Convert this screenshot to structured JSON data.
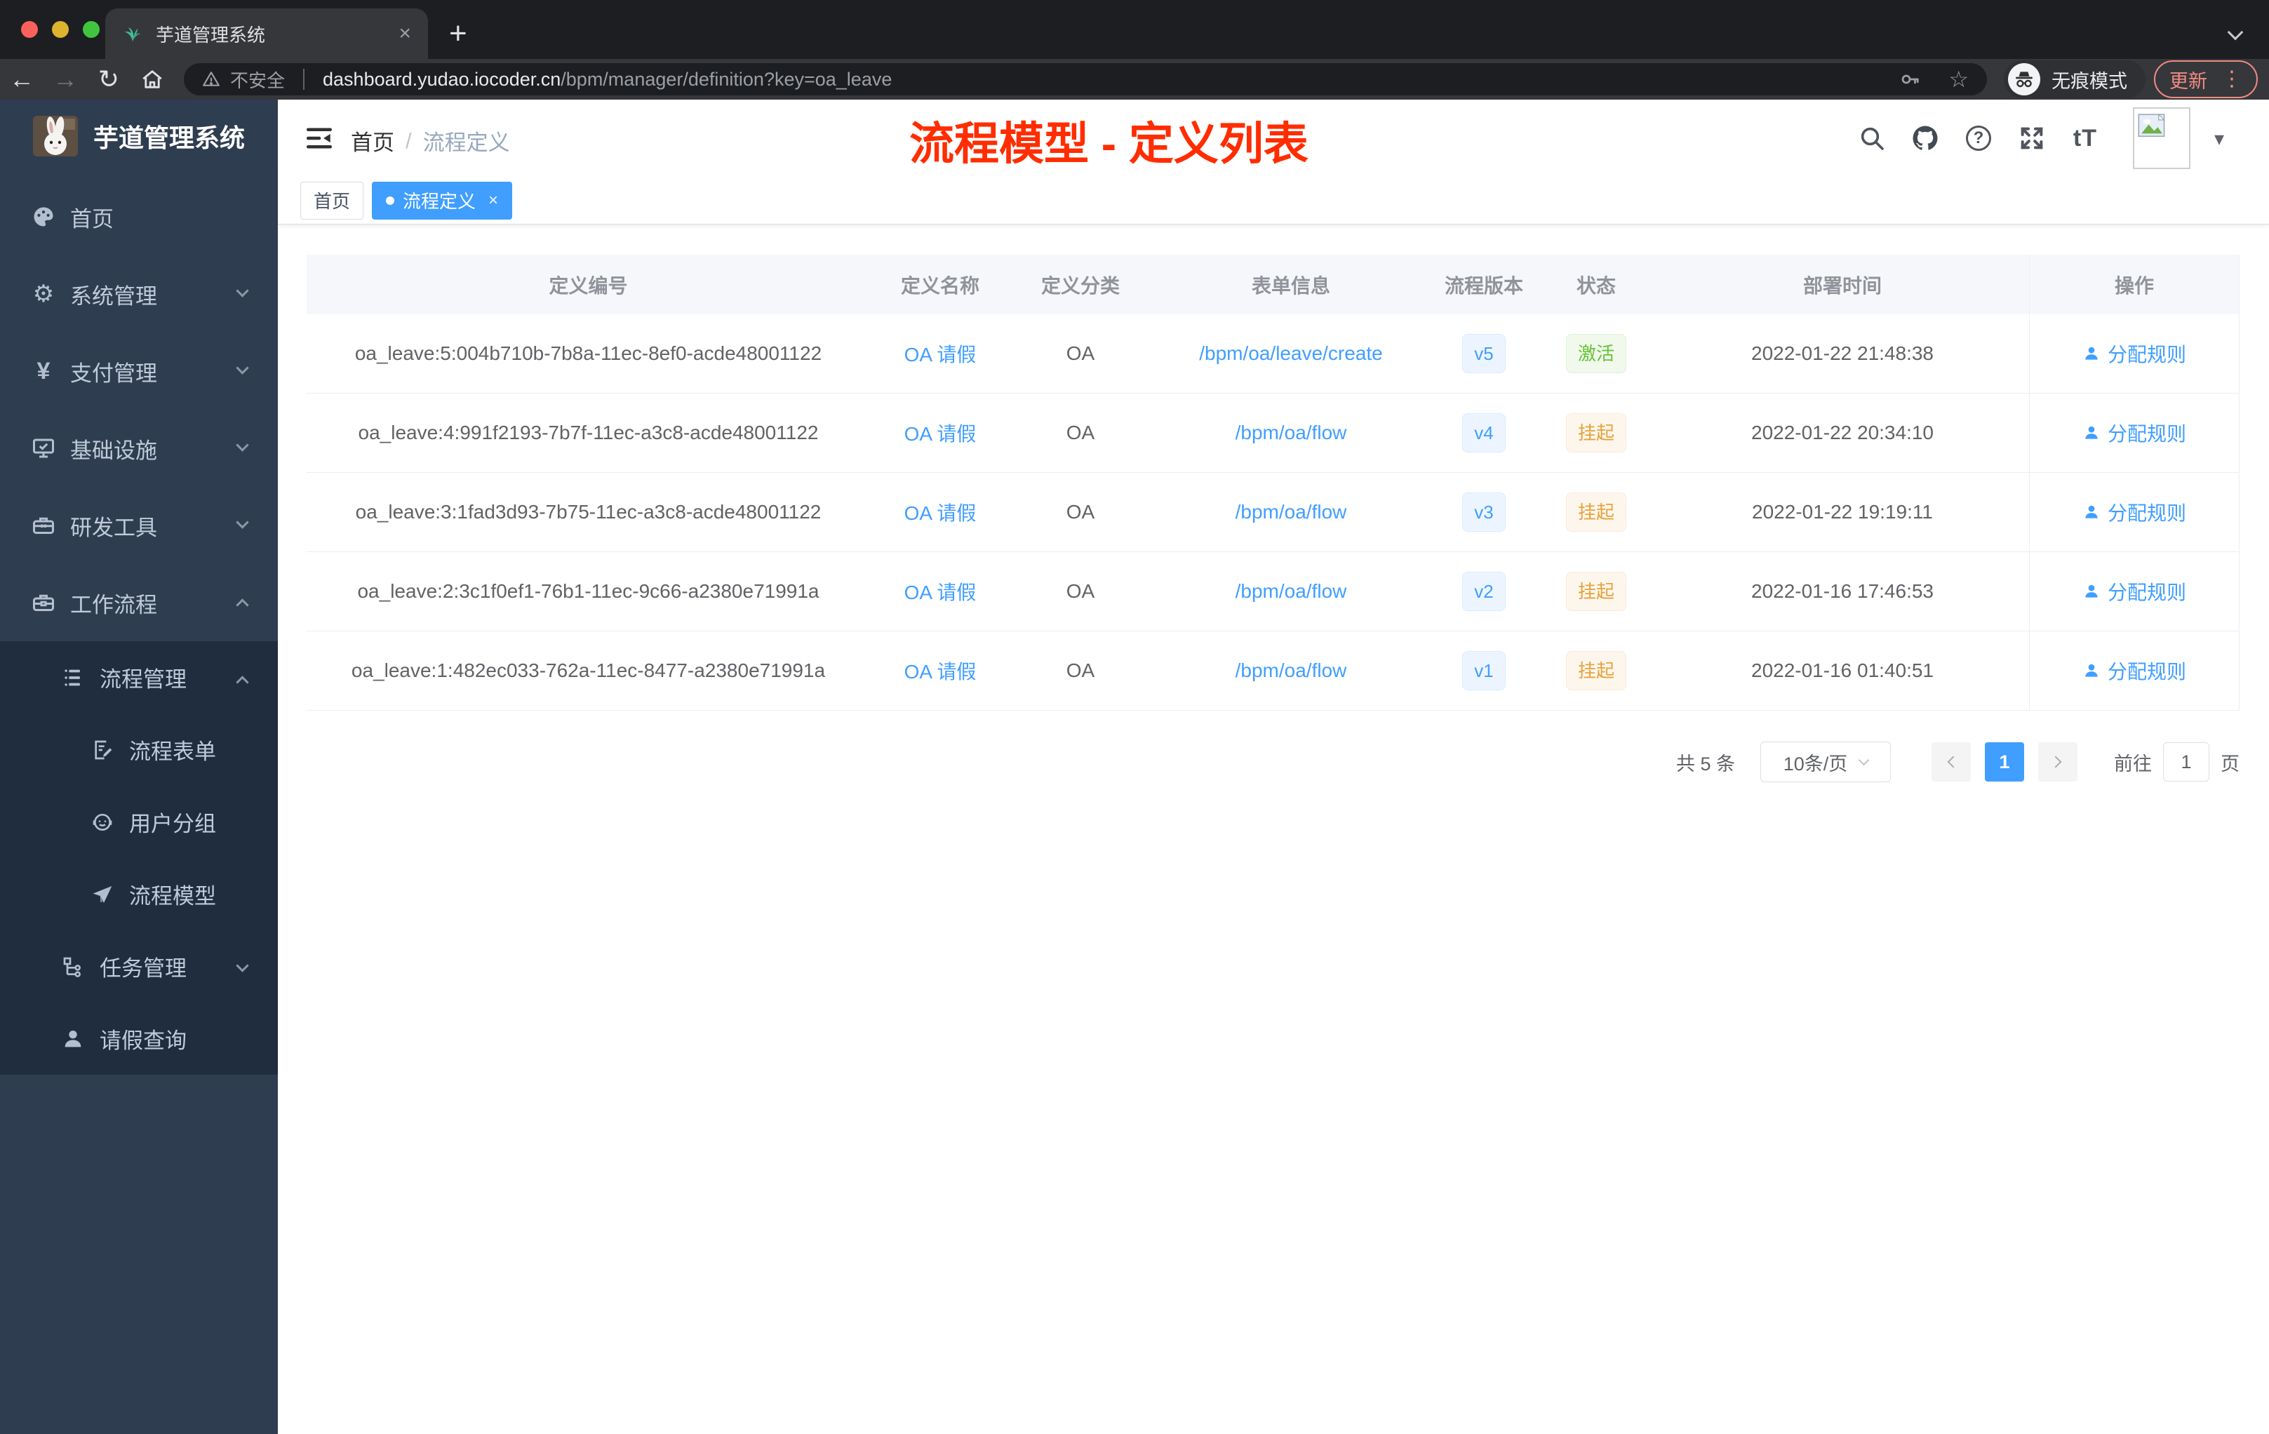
{
  "browser": {
    "tab": {
      "title": "芋道管理系统",
      "close_glyph": "×",
      "new_tab_glyph": "+"
    },
    "toolbar": {
      "back_glyph": "←",
      "forward_glyph": "→",
      "reload_glyph": "↻"
    },
    "omnibox": {
      "security_label": "不安全",
      "host": "dashboard.yudao.iocoder.cn",
      "path": "/bpm/manager/definition?key=oa_leave",
      "star_glyph": "☆"
    },
    "incognito_label": "无痕模式",
    "update_label": "更新",
    "menu_dots_glyph": "⋮"
  },
  "sidebar": {
    "brand_title": "芋道管理系统",
    "items": [
      {
        "label": "首页"
      },
      {
        "label": "系统管理"
      },
      {
        "label": "支付管理"
      },
      {
        "label": "基础设施"
      },
      {
        "label": "研发工具"
      },
      {
        "label": "工作流程"
      }
    ],
    "workflow_children": [
      {
        "label": "流程管理"
      },
      {
        "label": "流程表单"
      },
      {
        "label": "用户分组"
      },
      {
        "label": "流程模型"
      },
      {
        "label": "任务管理"
      },
      {
        "label": "请假查询"
      }
    ],
    "gear_glyph": "⚙",
    "yen_glyph": "¥"
  },
  "header": {
    "breadcrumb": {
      "home": "首页",
      "separator": "/",
      "current": "流程定义"
    },
    "annotation": "流程模型 - 定义列表",
    "help_glyph": "?",
    "font_size_glyph": "tT",
    "caret_glyph": "▾"
  },
  "tags": [
    {
      "label": "首页",
      "active": false
    },
    {
      "label": "流程定义",
      "active": true,
      "close_glyph": "×"
    }
  ],
  "table": {
    "columns": [
      "定义编号",
      "定义名称",
      "定义分类",
      "表单信息",
      "流程版本",
      "状态",
      "部署时间",
      "操作"
    ],
    "rows": [
      {
        "id": "oa_leave:5:004b710b-7b8a-11ec-8ef0-acde48001122",
        "name": "OA 请假",
        "category": "OA",
        "form": "/bpm/oa/leave/create",
        "version": "v5",
        "status": "激活",
        "time": "2022-01-22 21:48:38",
        "action": "分配规则"
      },
      {
        "id": "oa_leave:4:991f2193-7b7f-11ec-a3c8-acde48001122",
        "name": "OA 请假",
        "category": "OA",
        "form": "/bpm/oa/flow",
        "version": "v4",
        "status": "挂起",
        "time": "2022-01-22 20:34:10",
        "action": "分配规则"
      },
      {
        "id": "oa_leave:3:1fad3d93-7b75-11ec-a3c8-acde48001122",
        "name": "OA 请假",
        "category": "OA",
        "form": "/bpm/oa/flow",
        "version": "v3",
        "status": "挂起",
        "time": "2022-01-22 19:19:11",
        "action": "分配规则"
      },
      {
        "id": "oa_leave:2:3c1f0ef1-76b1-11ec-9c66-a2380e71991a",
        "name": "OA 请假",
        "category": "OA",
        "form": "/bpm/oa/flow",
        "version": "v2",
        "status": "挂起",
        "time": "2022-01-16 17:46:53",
        "action": "分配规则"
      },
      {
        "id": "oa_leave:1:482ec033-762a-11ec-8477-a2380e71991a",
        "name": "OA 请假",
        "category": "OA",
        "form": "/bpm/oa/flow",
        "version": "v1",
        "status": "挂起",
        "time": "2022-01-16 01:40:51",
        "action": "分配规则"
      }
    ]
  },
  "pagination": {
    "total": "共 5 条",
    "page_size": "10条/页",
    "current_page": "1",
    "goto_prefix": "前往",
    "goto_value": "1",
    "goto_suffix": "页"
  },
  "colors": {
    "accent_blue": "#409EFF",
    "status_active_green": "#67C23A",
    "status_suspend_yellow": "#E6A23C",
    "annotation_red": "#ff2d00",
    "sidebar_bg": "#2f3d50",
    "sidebar_submenu_bg": "#202d3e",
    "chrome_update_red": "#f28b82"
  }
}
